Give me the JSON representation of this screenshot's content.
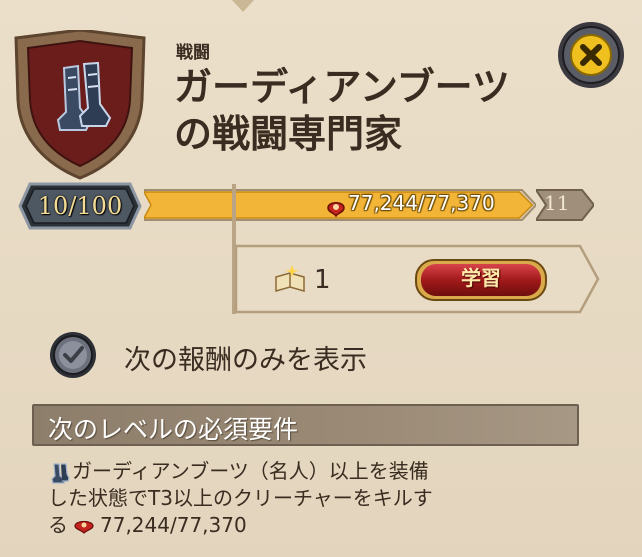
{
  "header": {
    "category": "戦闘",
    "title_line1": "ガーディアンブーツ",
    "title_line2": "の戦闘専門家"
  },
  "level": {
    "current_label": "10/100",
    "current": 10,
    "max": 100,
    "next": "11"
  },
  "progress": {
    "label": "77,244/77,370",
    "value": 77244,
    "target": 77370,
    "fraction": 0.998
  },
  "reward": {
    "count": "1",
    "learn_label": "学習"
  },
  "filter": {
    "label": "次の報酬のみを表示"
  },
  "requirements": {
    "header": "次のレベルの必須要件",
    "text_line1": "ガーディアンブーツ（名人）以上を装備",
    "text_line2": "した状態でT3以上のクリーチャーをキルす",
    "text_line3_prefix": "る",
    "progress": "77,244/77,370"
  },
  "icons": {
    "item": "boots-icon",
    "close": "close-icon",
    "kill": "kill-fame-icon",
    "book": "tome-icon",
    "checkbox": "checkmark-icon"
  },
  "colors": {
    "panel": "#e6d9c3",
    "progress_fill": "#f3b538",
    "learn_button": "#a21a1a",
    "section_header": "#8d7e6b",
    "close_button": "#f0c020"
  }
}
